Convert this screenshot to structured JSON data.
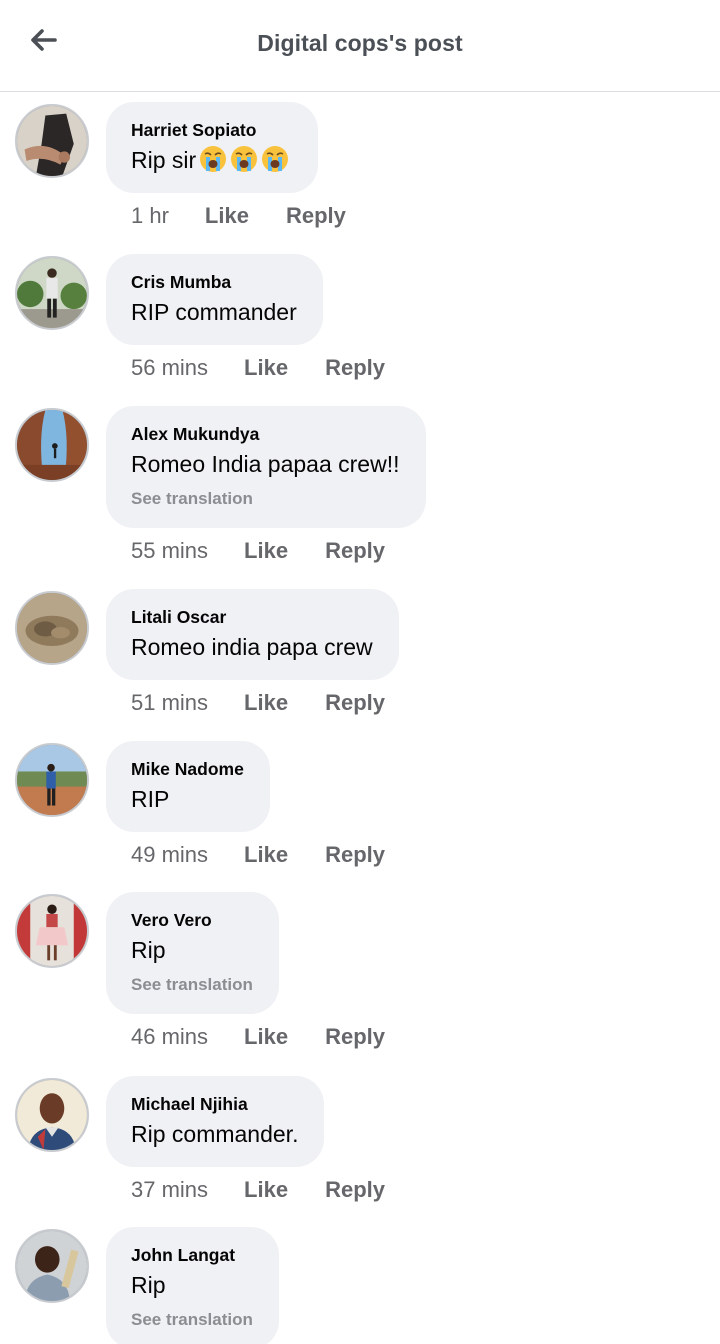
{
  "header": {
    "title": "Digital cops's post",
    "back_icon": "arrow-left-icon"
  },
  "actions": {
    "like": "Like",
    "reply": "Reply"
  },
  "comments": [
    {
      "author": "Harriet Sopiato",
      "text": "Rip  sir",
      "emoji": [
        "loudly-crying-face-icon",
        "loudly-crying-face-icon",
        "loudly-crying-face-icon"
      ],
      "time": "1 hr"
    },
    {
      "author": "Cris Mumba",
      "text": "RIP commander",
      "time": "56 mins"
    },
    {
      "author": "Alex Mukundya",
      "text": "Romeo India papaa crew!!",
      "translation": "See translation",
      "time": "55 mins"
    },
    {
      "author": "Litali Oscar",
      "text": "Romeo india papa crew",
      "time": "51 mins"
    },
    {
      "author": "Mike Nadome",
      "text": "RIP",
      "time": "49 mins"
    },
    {
      "author": "Vero Vero",
      "text": "Rip",
      "translation": "See translation",
      "time": "46 mins"
    },
    {
      "author": "Michael Njihia",
      "text": "Rip commander.",
      "time": "37 mins"
    },
    {
      "author": "John Langat",
      "text": "Rip",
      "translation": "See translation"
    }
  ]
}
